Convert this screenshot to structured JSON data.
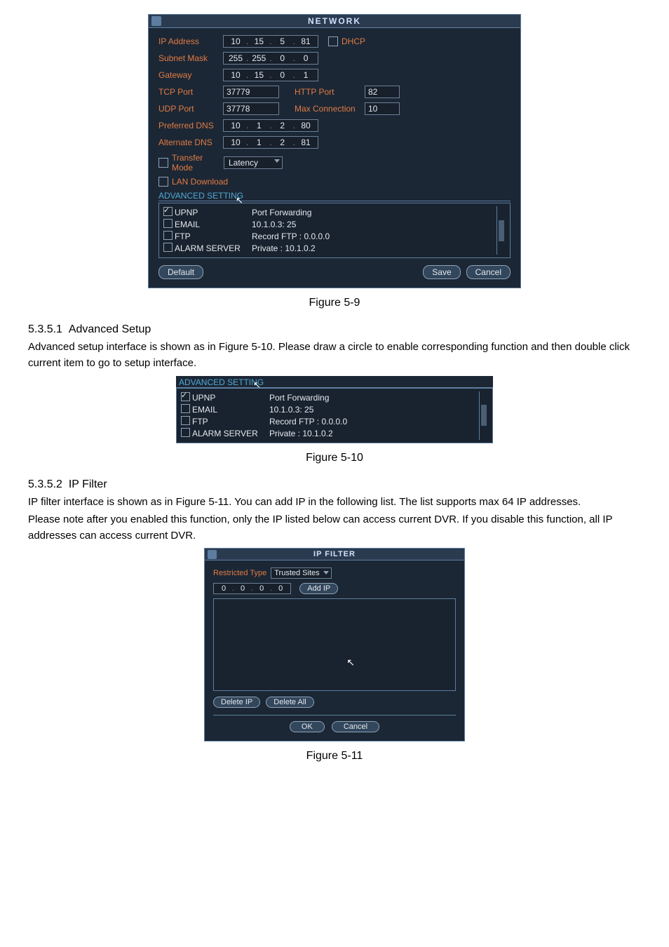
{
  "fig59": {
    "title": "NETWORK",
    "labels": {
      "ip": "IP Address",
      "subnet": "Subnet Mask",
      "gateway": "Gateway",
      "tcp": "TCP Port",
      "udp": "UDP Port",
      "httpport": "HTTP Port",
      "maxconn": "Max Connection",
      "pref": "Preferred DNS",
      "alt": "Alternate DNS",
      "transfer": "Transfer Mode",
      "lan": "LAN Download",
      "dhcp": "DHCP"
    },
    "values": {
      "ip": [
        "10",
        "15",
        "5",
        "81"
      ],
      "subnet": [
        "255",
        "255",
        "0",
        "0"
      ],
      "gateway": [
        "10",
        "15",
        "0",
        "1"
      ],
      "tcp": "37779",
      "http": "82",
      "udp": "37778",
      "maxconn": "10",
      "pref": [
        "10",
        "1",
        "2",
        "80"
      ],
      "alt": [
        "10",
        "1",
        "2",
        "81"
      ],
      "transfer": "Latency"
    },
    "advhdr": "ADVANCED SETTING",
    "adv": [
      {
        "name": "UPNP",
        "val": "Port Forwarding",
        "checked": true
      },
      {
        "name": "EMAIL",
        "val": "10.1.0.3: 25",
        "checked": false
      },
      {
        "name": "FTP",
        "val": "Record FTP : 0.0.0.0",
        "checked": false
      },
      {
        "name": "ALARM SERVER",
        "val": "Private : 10.1.0.2",
        "checked": false
      }
    ],
    "buttons": {
      "default": "Default",
      "save": "Save",
      "cancel": "Cancel"
    }
  },
  "captions": {
    "f59": "Figure 5-9",
    "f510": "Figure 5-10",
    "f511": "Figure 5-11"
  },
  "sec5351": {
    "num": "5.3.5.1",
    "title": "Advanced Setup",
    "p1": "Advanced setup interface is shown as in Figure 5-10. Please draw a circle to enable corresponding function and then double click current item to go to setup interface."
  },
  "fig510": {
    "advhdr": "ADVANCED SETTING",
    "adv": [
      {
        "name": "UPNP",
        "val": "Port Forwarding",
        "checked": true
      },
      {
        "name": "EMAIL",
        "val": "10.1.0.3: 25",
        "checked": false
      },
      {
        "name": "FTP",
        "val": "Record FTP : 0.0.0.0",
        "checked": false
      },
      {
        "name": "ALARM SERVER",
        "val": "Private : 10.1.0.2",
        "checked": false
      }
    ]
  },
  "sec5352": {
    "num": "5.3.5.2",
    "title": "IP Filter",
    "p1": "IP filter interface is shown as in Figure 5-11. You can add IP in the following list.  The list supports max 64 IP addresses.",
    "p2": "Please note after you enabled this function, only the IP listed below can access current DVR. If you disable this function, all IP addresses can access current DVR."
  },
  "fig511": {
    "title": "IP FILTER",
    "restricted_label": "Restricted Type",
    "restricted_value": "Trusted Sites",
    "ip": [
      "0",
      "0",
      "0",
      "0"
    ],
    "buttons": {
      "add": "Add IP",
      "delip": "Delete IP",
      "delall": "Delete All",
      "ok": "OK",
      "cancel": "Cancel"
    }
  }
}
